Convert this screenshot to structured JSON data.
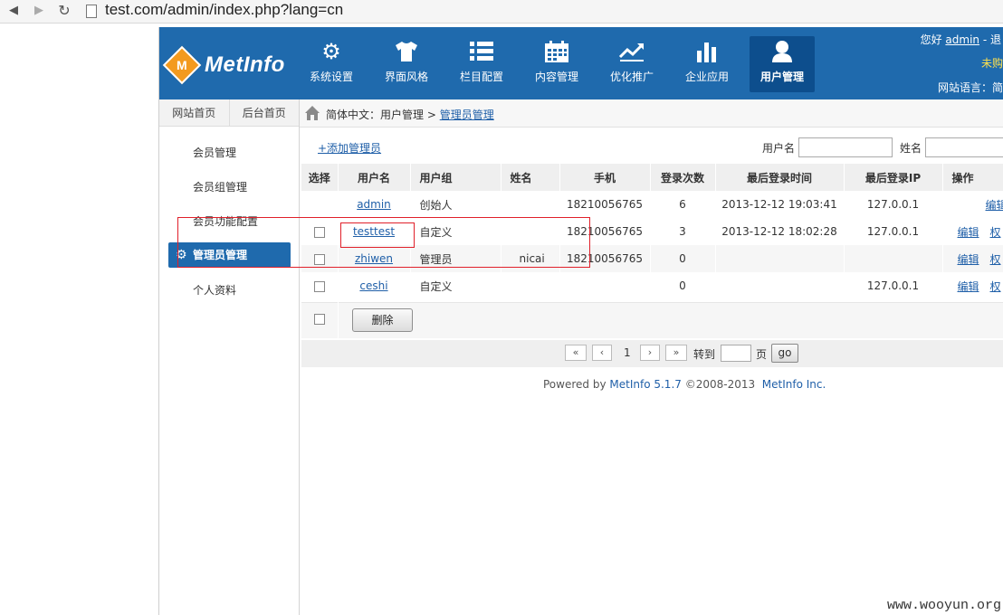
{
  "browser": {
    "url": "test.com/admin/index.php?lang=cn",
    "back_icon": "◀",
    "forward_icon": "▶",
    "reload_icon": "↻"
  },
  "header": {
    "logo_letter": "M",
    "logo_text": "MetInfo",
    "nav": [
      {
        "label": "系统设置",
        "icon": "gear-icon",
        "glyph": "⚙"
      },
      {
        "label": "界面风格",
        "icon": "tshirt-icon",
        "glyph": "👕"
      },
      {
        "label": "栏目配置",
        "icon": "list-icon",
        "glyph": "☰"
      },
      {
        "label": "内容管理",
        "icon": "calendar-icon",
        "glyph": "▦"
      },
      {
        "label": "优化推广",
        "icon": "trend-icon",
        "glyph": "〽"
      },
      {
        "label": "企业应用",
        "icon": "bar-chart-icon",
        "glyph": "▮"
      },
      {
        "label": "用户管理",
        "icon": "user-icon",
        "glyph": "👤"
      }
    ],
    "greeting": "您好",
    "username": "admin",
    "greeting_suffix": "- 退",
    "notice": "未购",
    "lang_label": "网站语言：",
    "lang_value": "简"
  },
  "sidebar": {
    "tabs": [
      "网站首页",
      "后台首页"
    ],
    "items": [
      "会员管理",
      "会员组管理",
      "会员功能配置",
      "管理员管理",
      "个人资料"
    ],
    "active_index": 3
  },
  "breadcrumb": {
    "prefix": "简体中文：用户管理 >",
    "current": "管理员管理"
  },
  "toolbar": {
    "add_label": "+添加管理员",
    "search_username_label": "用户名",
    "search_name_label": "姓名"
  },
  "table": {
    "headers": [
      "选择",
      "用户名",
      "用户组",
      "姓名",
      "手机",
      "登录次数",
      "最后登录时间",
      "最后登录IP",
      "操作"
    ],
    "rows": [
      {
        "checkbox": false,
        "username": "admin",
        "group": "创始人",
        "name": "",
        "phone": "18210056765",
        "logins": "6",
        "last_time": "2013-12-12 19:03:41",
        "last_ip": "127.0.0.1",
        "ops": [
          "编辑"
        ]
      },
      {
        "checkbox": true,
        "username": "testtest",
        "group": "自定义",
        "name": "",
        "phone": "18210056765",
        "logins": "3",
        "last_time": "2013-12-12 18:02:28",
        "last_ip": "127.0.0.1",
        "ops": [
          "编辑",
          "权"
        ]
      },
      {
        "checkbox": true,
        "username": "zhiwen",
        "group": "管理员",
        "name": "nicai",
        "phone": "18210056765",
        "logins": "0",
        "last_time": "",
        "last_ip": "",
        "ops": [
          "编辑",
          "权"
        ]
      },
      {
        "checkbox": true,
        "username": "ceshi",
        "group": "自定义",
        "name": "",
        "phone": "",
        "logins": "0",
        "last_time": "",
        "last_ip": "127.0.0.1",
        "ops": [
          "编辑",
          "权"
        ]
      }
    ],
    "delete_label": "删除"
  },
  "pager": {
    "first": "«",
    "prev": "‹",
    "page": "1",
    "next": "›",
    "last": "»",
    "goto_label": "转到",
    "page_label": "页",
    "go_label": "go"
  },
  "footer": {
    "powered_prefix": "Powered by",
    "product": "MetInfo 5.1.7",
    "copyright": "©2008-2013",
    "company": "MetInfo Inc."
  },
  "watermark": "www.wooyun.org",
  "colors": {
    "header_bg": "#1f6aad",
    "active_nav_bg": "#0d4e8d",
    "logo_orange": "#f39a1e",
    "link_blue": "#1f5fa8",
    "highlight_red": "#e0202a"
  }
}
